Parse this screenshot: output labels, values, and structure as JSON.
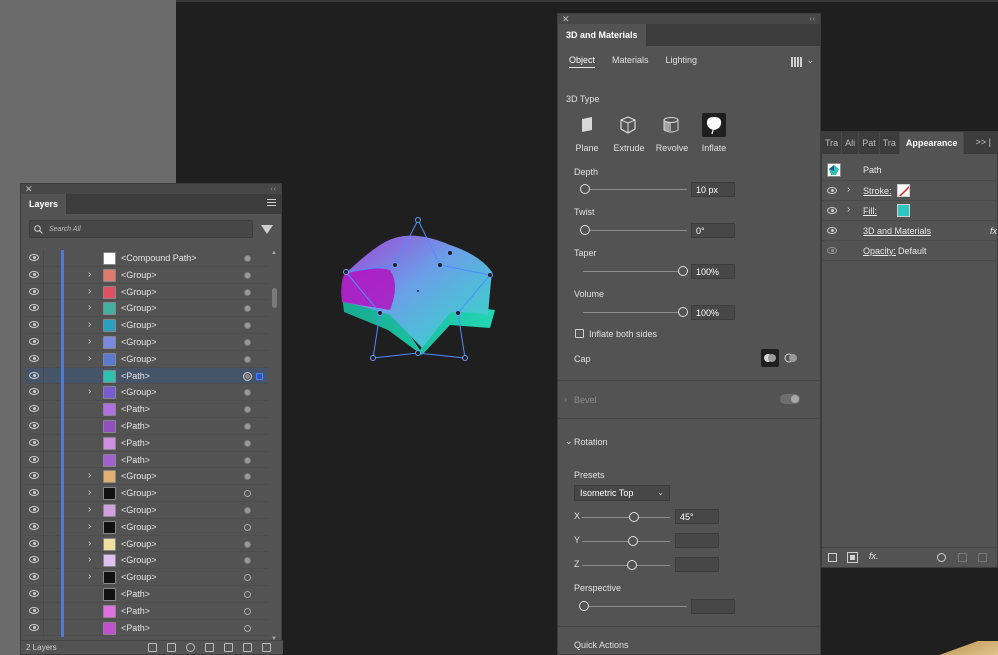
{
  "layers_panel": {
    "tab_title": "Layers",
    "search_placeholder": "Search All",
    "rows": [
      {
        "label": "<Compound Path>",
        "expandable": false,
        "thumb": "#ffffff",
        "target": "filled"
      },
      {
        "label": "<Group>",
        "expandable": true,
        "thumb": "#e07a6a",
        "target": "filled"
      },
      {
        "label": "<Group>",
        "expandable": true,
        "thumb": "#e05060",
        "target": "filled"
      },
      {
        "label": "<Group>",
        "expandable": true,
        "thumb": "#40b0a0",
        "target": "filled"
      },
      {
        "label": "<Group>",
        "expandable": true,
        "thumb": "#2aa0c0",
        "target": "filled"
      },
      {
        "label": "<Group>",
        "expandable": true,
        "thumb": "#7a8adf",
        "target": "filled"
      },
      {
        "label": "<Group>",
        "expandable": true,
        "thumb": "#5a7ad0",
        "target": "filled"
      },
      {
        "label": "<Path>",
        "expandable": false,
        "thumb": "#2ec0b0",
        "target": "ringed",
        "selected": true
      },
      {
        "label": "<Group>",
        "expandable": true,
        "thumb": "#7a5ad0",
        "target": "filled"
      },
      {
        "label": "<Path>",
        "expandable": false,
        "thumb": "#b070e0",
        "target": "filled"
      },
      {
        "label": "<Path>",
        "expandable": false,
        "thumb": "#9050c0",
        "target": "filled"
      },
      {
        "label": "<Path>",
        "expandable": false,
        "thumb": "#d090e0",
        "target": "filled"
      },
      {
        "label": "<Path>",
        "expandable": false,
        "thumb": "#a060d0",
        "target": "filled"
      },
      {
        "label": "<Group>",
        "expandable": true,
        "thumb": "#e0b070",
        "target": "filled"
      },
      {
        "label": "<Group>",
        "expandable": true,
        "thumb": "#111111",
        "target": "hollow"
      },
      {
        "label": "<Group>",
        "expandable": true,
        "thumb": "#d0a0e0",
        "target": "filled"
      },
      {
        "label": "<Group>",
        "expandable": true,
        "thumb": "#111111",
        "target": "hollow"
      },
      {
        "label": "<Group>",
        "expandable": true,
        "thumb": "#f0e0a0",
        "target": "filled"
      },
      {
        "label": "<Group>",
        "expandable": true,
        "thumb": "#e0c0f0",
        "target": "filled"
      },
      {
        "label": "<Group>",
        "expandable": true,
        "thumb": "#111111",
        "target": "hollow"
      },
      {
        "label": "<Path>",
        "expandable": false,
        "thumb": "#111111",
        "target": "hollow"
      },
      {
        "label": "<Path>",
        "expandable": false,
        "thumb": "#e070e0",
        "target": "hollow"
      },
      {
        "label": "<Path>",
        "expandable": false,
        "thumb": "#c050d0",
        "target": "hollow"
      }
    ],
    "footer_text": "2 Layers"
  },
  "materials_panel": {
    "tab_title": "3D and Materials",
    "subtabs": [
      "Object",
      "Materials",
      "Lighting"
    ],
    "active_subtab": "Object",
    "type_section": "3D Type",
    "types": [
      {
        "label": "Plane",
        "icon": "plane-icon"
      },
      {
        "label": "Extrude",
        "icon": "extrude-icon"
      },
      {
        "label": "Revolve",
        "icon": "revolve-icon"
      },
      {
        "label": "Inflate",
        "icon": "inflate-icon",
        "active": true
      }
    ],
    "depth": {
      "label": "Depth",
      "value": "10 px",
      "fraction": 0.0
    },
    "twist": {
      "label": "Twist",
      "value": "0°",
      "fraction": 0.0
    },
    "taper": {
      "label": "Taper",
      "value": "100%",
      "fraction": 1.0
    },
    "volume": {
      "label": "Volume",
      "value": "100%",
      "fraction": 1.0
    },
    "inflate_both_sides": "Inflate both sides",
    "cap": "Cap",
    "bevel": "Bevel",
    "rotation": "Rotation",
    "presets_label": "Presets",
    "preset_value": "Isometric Top",
    "x": {
      "label": "X",
      "value": "45°"
    },
    "y": {
      "label": "Y",
      "value": ""
    },
    "z": {
      "label": "Z",
      "value": ""
    },
    "perspective": {
      "label": "Perspective",
      "value": ""
    },
    "quick_actions": "Quick Actions"
  },
  "appearance_panel": {
    "tabs": [
      "Tra",
      "Ali",
      "Pat",
      "Tra",
      "Appearance"
    ],
    "active_tab": "Appearance",
    "object_label": "Path",
    "stroke_label": "Stroke:",
    "fill_label": "Fill:",
    "effect_label": "3D and Materials",
    "opacity_label": "Opacity:",
    "opacity_value": "Default",
    "fx_label": "fx",
    "footer_fx": "fx."
  },
  "colors": {
    "panel_bg": "#535353",
    "accent_blue": "#4f7bd8",
    "selection_row": "#46546a",
    "fill_swatch": "#2ec6c0"
  }
}
